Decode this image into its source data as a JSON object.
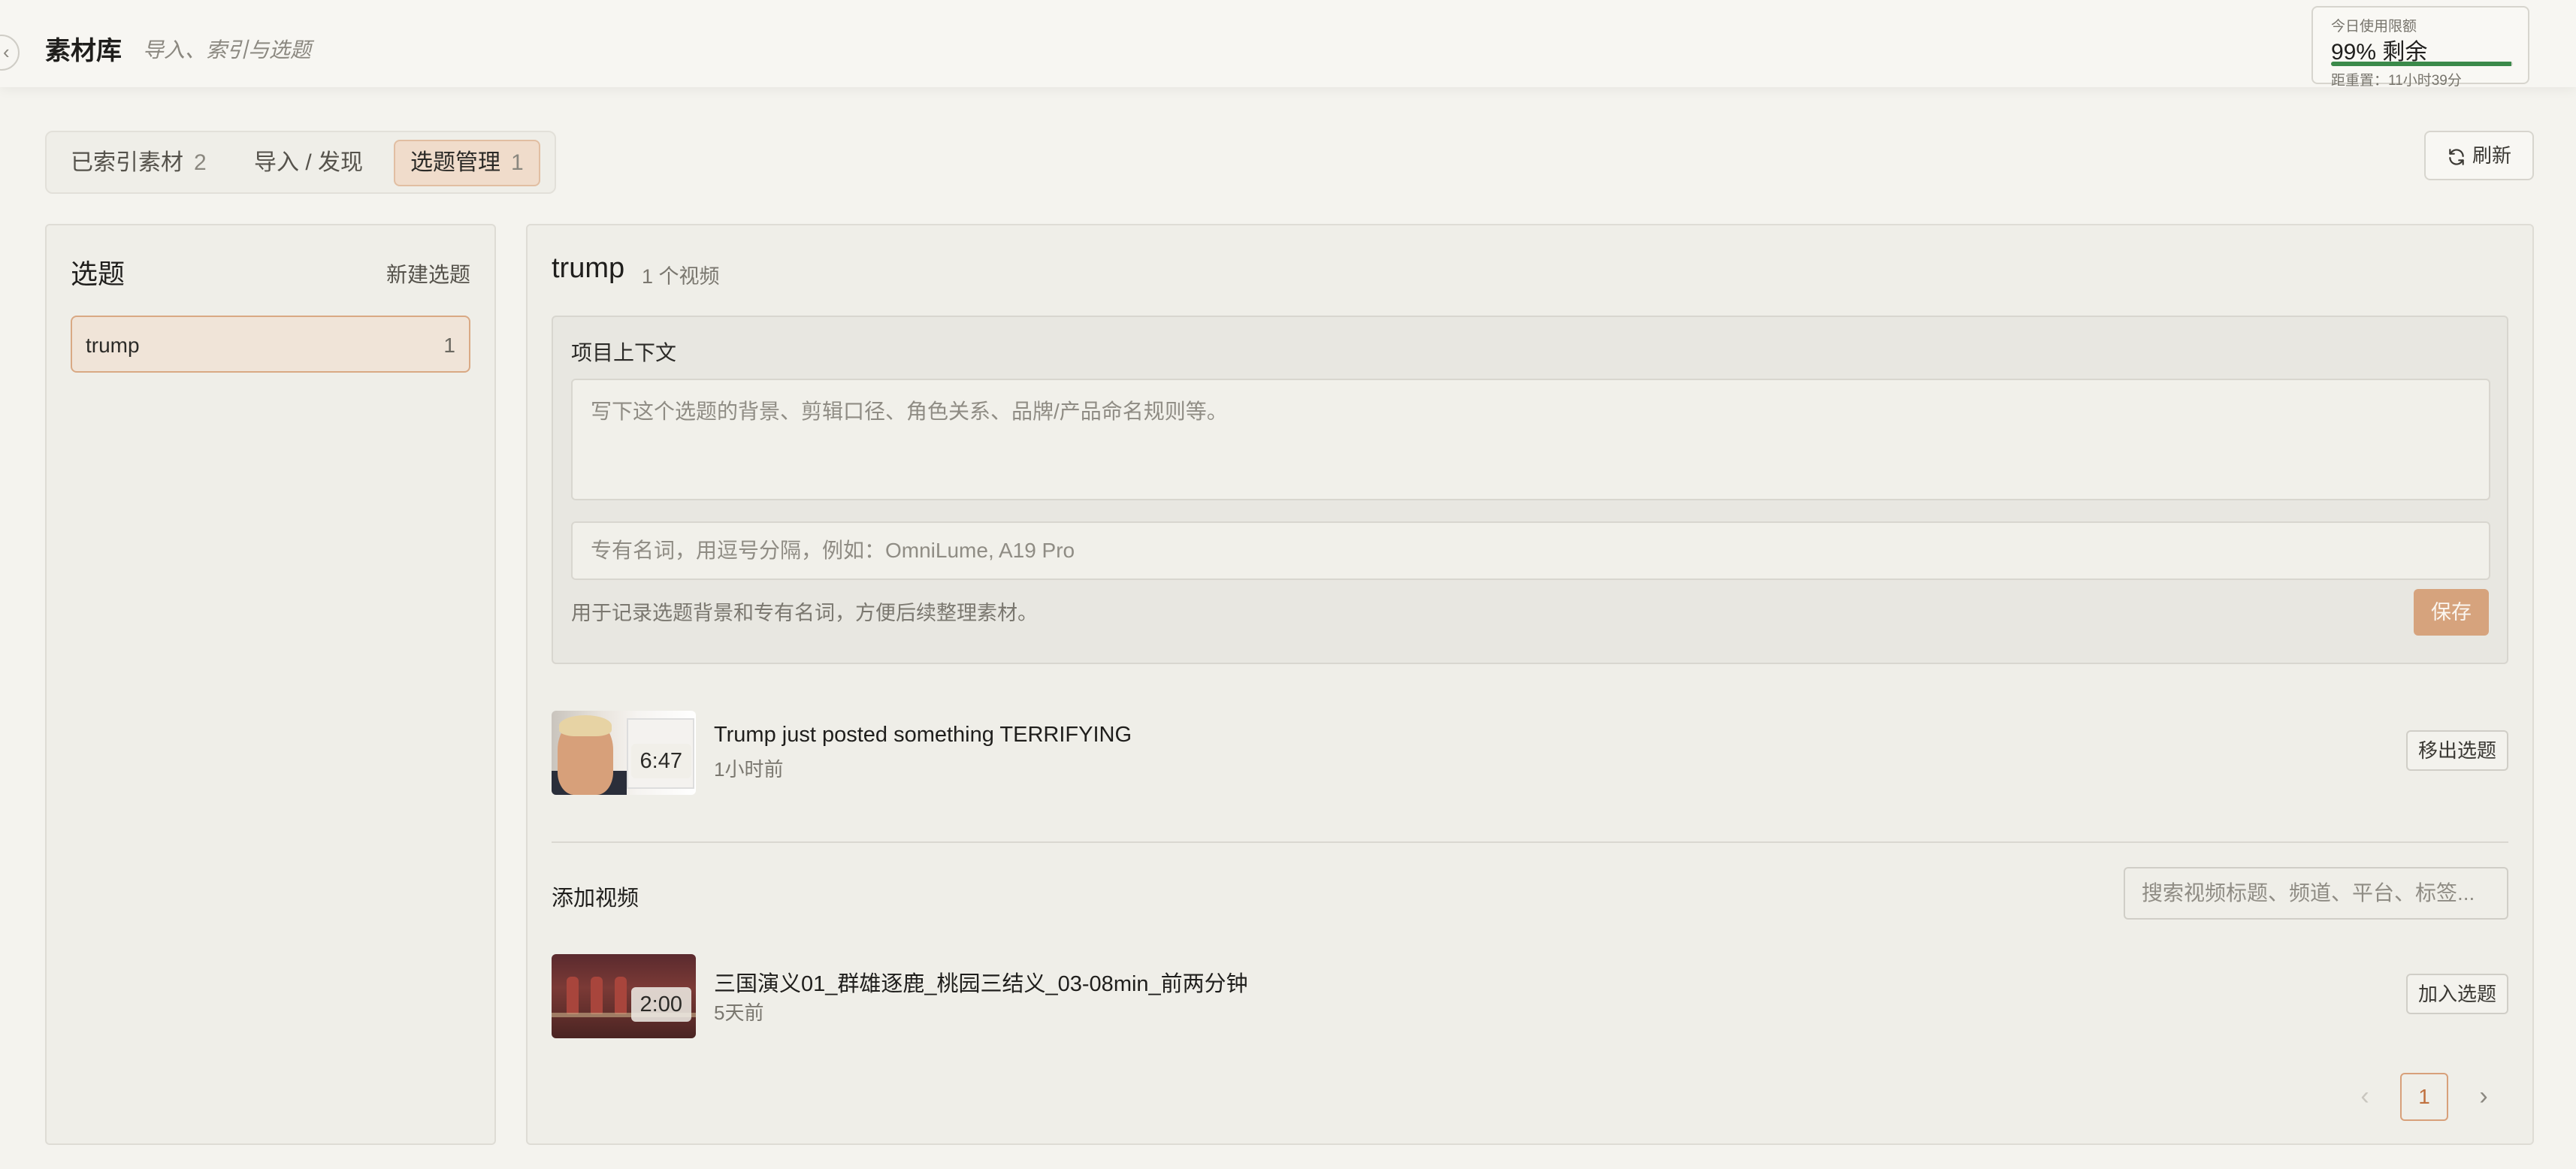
{
  "header": {
    "title": "素材库",
    "subtitle": "导入、索引与选题"
  },
  "usage": {
    "label": "今日使用限额",
    "value": "99% 剩余",
    "fraction": 0.99,
    "reset": "距重置：11小时39分",
    "bar_color": "#3b8a4a"
  },
  "tabs": [
    {
      "label": "已索引素材",
      "count": "2"
    },
    {
      "label": "导入 / 发现",
      "count": ""
    },
    {
      "label": "选题管理",
      "count": "1",
      "active": true
    }
  ],
  "refresh": {
    "label": "刷新",
    "icon": "refresh-icon"
  },
  "topics_panel": {
    "title": "选题",
    "new_label": "新建选题",
    "items": [
      {
        "name": "trump",
        "count": "1"
      }
    ]
  },
  "main": {
    "topic_name": "trump",
    "topic_videos": "1 个视频",
    "context": {
      "label": "项目上下文",
      "textarea_placeholder": "写下这个选题的背景、剪辑口径、角色关系、品牌/产品命名规则等。",
      "terms_placeholder": "专有名词，用逗号分隔，例如：OmniLume, A19 Pro",
      "hint": "用于记录选题背景和专有名词，方便后续整理素材。",
      "save_label": "保存"
    },
    "topic_videos_list": [
      {
        "title": "Trump just posted something TERRIFYING",
        "time": "1小时前",
        "duration": "6:47",
        "action": "移出选题"
      }
    ],
    "add_section": {
      "label": "添加视频",
      "search_placeholder": "搜索视频标题、频道、平台、标签..."
    },
    "candidate_videos": [
      {
        "title": "三国演义01_群雄逐鹿_桃园三结义_03-08min_前两分钟",
        "time": "5天前",
        "duration": "2:00",
        "action": "加入选题"
      }
    ],
    "pagination": {
      "current": "1",
      "prev_icon": "chevron-left-icon",
      "next_icon": "chevron-right-icon"
    }
  },
  "colors": {
    "accent": "#d6a37d",
    "accent_border": "#d9a984",
    "background": "#f4f3ee"
  }
}
